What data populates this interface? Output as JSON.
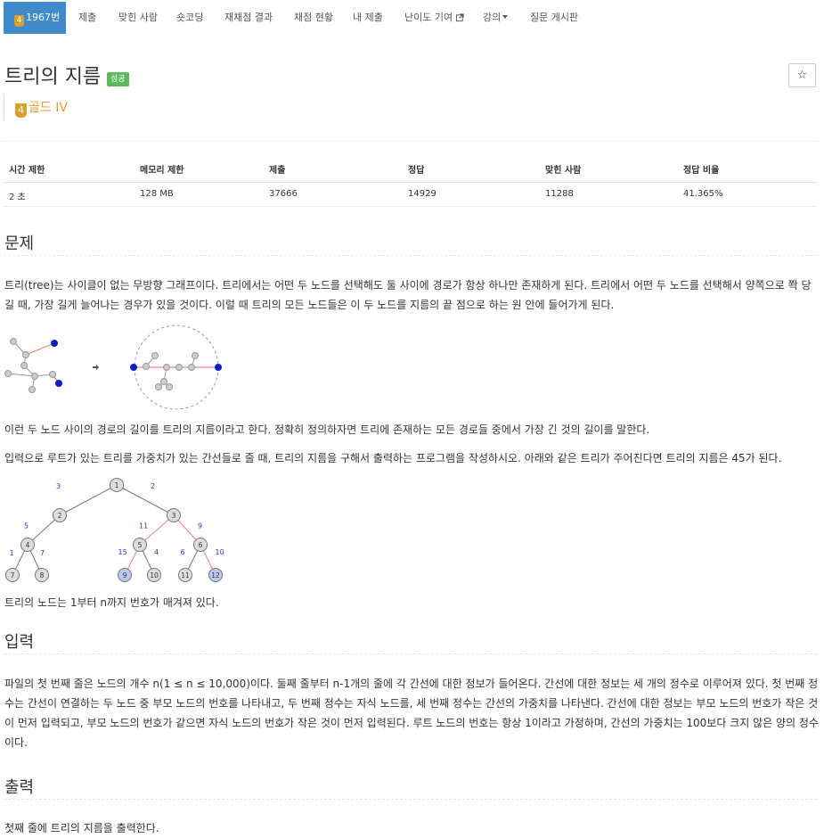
{
  "nav": {
    "active_tier": "4",
    "active_label": "1967번",
    "items": [
      "제출",
      "맞힌 사람",
      "숏코딩",
      "재채점 결과",
      "채점 현황",
      "내 제출",
      "난이도 기여",
      "강의",
      "질문 게시판"
    ]
  },
  "problem": {
    "title": "트리의 지름",
    "status": "성공",
    "star": "☆",
    "tier_icon": "4",
    "tier": "골드 IV"
  },
  "stats": {
    "headers": [
      "시간 제한",
      "메모리 제한",
      "제출",
      "정답",
      "맞힌 사람",
      "정답 비율"
    ],
    "values": [
      "2 초",
      "128 MB",
      "37666",
      "14929",
      "11288",
      "41.365%"
    ]
  },
  "sections": {
    "problem": {
      "heading": "문제",
      "p1": "트리(tree)는 사이클이 없는 무방향 그래프이다. 트리에서는 어떤 두 노드를 선택해도 둘 사이에 경로가 항상 하나만 존재하게 된다. 트리에서 어떤 두 노드를 선택해서 양쪽으로 쫙 당길 때, 가장 길게 늘어나는 경우가 있을 것이다. 이럴 때 트리의 모든 노드들은 이 두 노드를 지름의 끝 점으로 하는 원 안에 들어가게 된다.",
      "p2": "이런 두 노드 사이의 경로의 길이를 트리의 지름이라고 한다. 정확히 정의하자면 트리에 존재하는 모든 경로들 중에서 가장 긴 것의 길이를 말한다.",
      "p3": "입력으로 루트가 있는 트리를 가중치가 있는 간선들로 줄 때, 트리의 지름을 구해서 출력하는 프로그램을 작성하시오. 아래와 같은 트리가 주어진다면 트리의 지름은 45가 된다.",
      "p4": "트리의 노드는 1부터 n까지 번호가 매겨져 있다."
    },
    "input": {
      "heading": "입력",
      "p1": "파일의 첫 번째 줄은 노드의 개수 n(1 ≤ n ≤ 10,000)이다. 둘째 줄부터 n-1개의 줄에 각 간선에 대한 정보가 들어온다. 간선에 대한 정보는 세 개의 정수로 이루어져 있다. 첫 번째 정수는 간선이 연결하는 두 노드 중 부모 노드의 번호를 나타내고, 두 번째 정수는 자식 노드를, 세 번째 정수는 간선의 가중치를 나타낸다. 간선에 대한 정보는 부모 노드의 번호가 작은 것이 먼저 입력되고, 부모 노드의 번호가 같으면 자식 노드의 번호가 작은 것이 먼저 입력된다. 루트 노드의 번호는 항상 1이라고 가정하며, 간선의 가중치는 100보다 크지 않은 양의 정수이다."
    },
    "output": {
      "heading": "출력",
      "p1": "첫째 줄에 트리의 지름을 출력한다."
    }
  },
  "figure_tree": {
    "nodes": [
      "1",
      "2",
      "3",
      "4",
      "5",
      "6",
      "7",
      "8",
      "9",
      "10",
      "11",
      "12"
    ],
    "edges": [
      {
        "from": "1",
        "to": "2",
        "w": "3"
      },
      {
        "from": "1",
        "to": "3",
        "w": "2"
      },
      {
        "from": "2",
        "to": "4",
        "w": "5"
      },
      {
        "from": "3",
        "to": "5",
        "w": "11"
      },
      {
        "from": "3",
        "to": "6",
        "w": "9"
      },
      {
        "from": "4",
        "to": "7",
        "w": "1"
      },
      {
        "from": "4",
        "to": "8",
        "w": "7"
      },
      {
        "from": "5",
        "to": "9",
        "w": "15"
      },
      {
        "from": "5",
        "to": "10",
        "w": "4"
      },
      {
        "from": "6",
        "to": "11",
        "w": "6"
      },
      {
        "from": "6",
        "to": "12",
        "w": "10"
      }
    ],
    "diameter_path": [
      "9",
      "5",
      "3",
      "6",
      "12"
    ]
  },
  "colors": {
    "accent": "#428bca",
    "success": "#5cb85c",
    "gold": "#d9a030",
    "diameter_edge": "#e8847a",
    "endpoint": "#0a1fbf",
    "weight_label": "#2a35d6"
  }
}
